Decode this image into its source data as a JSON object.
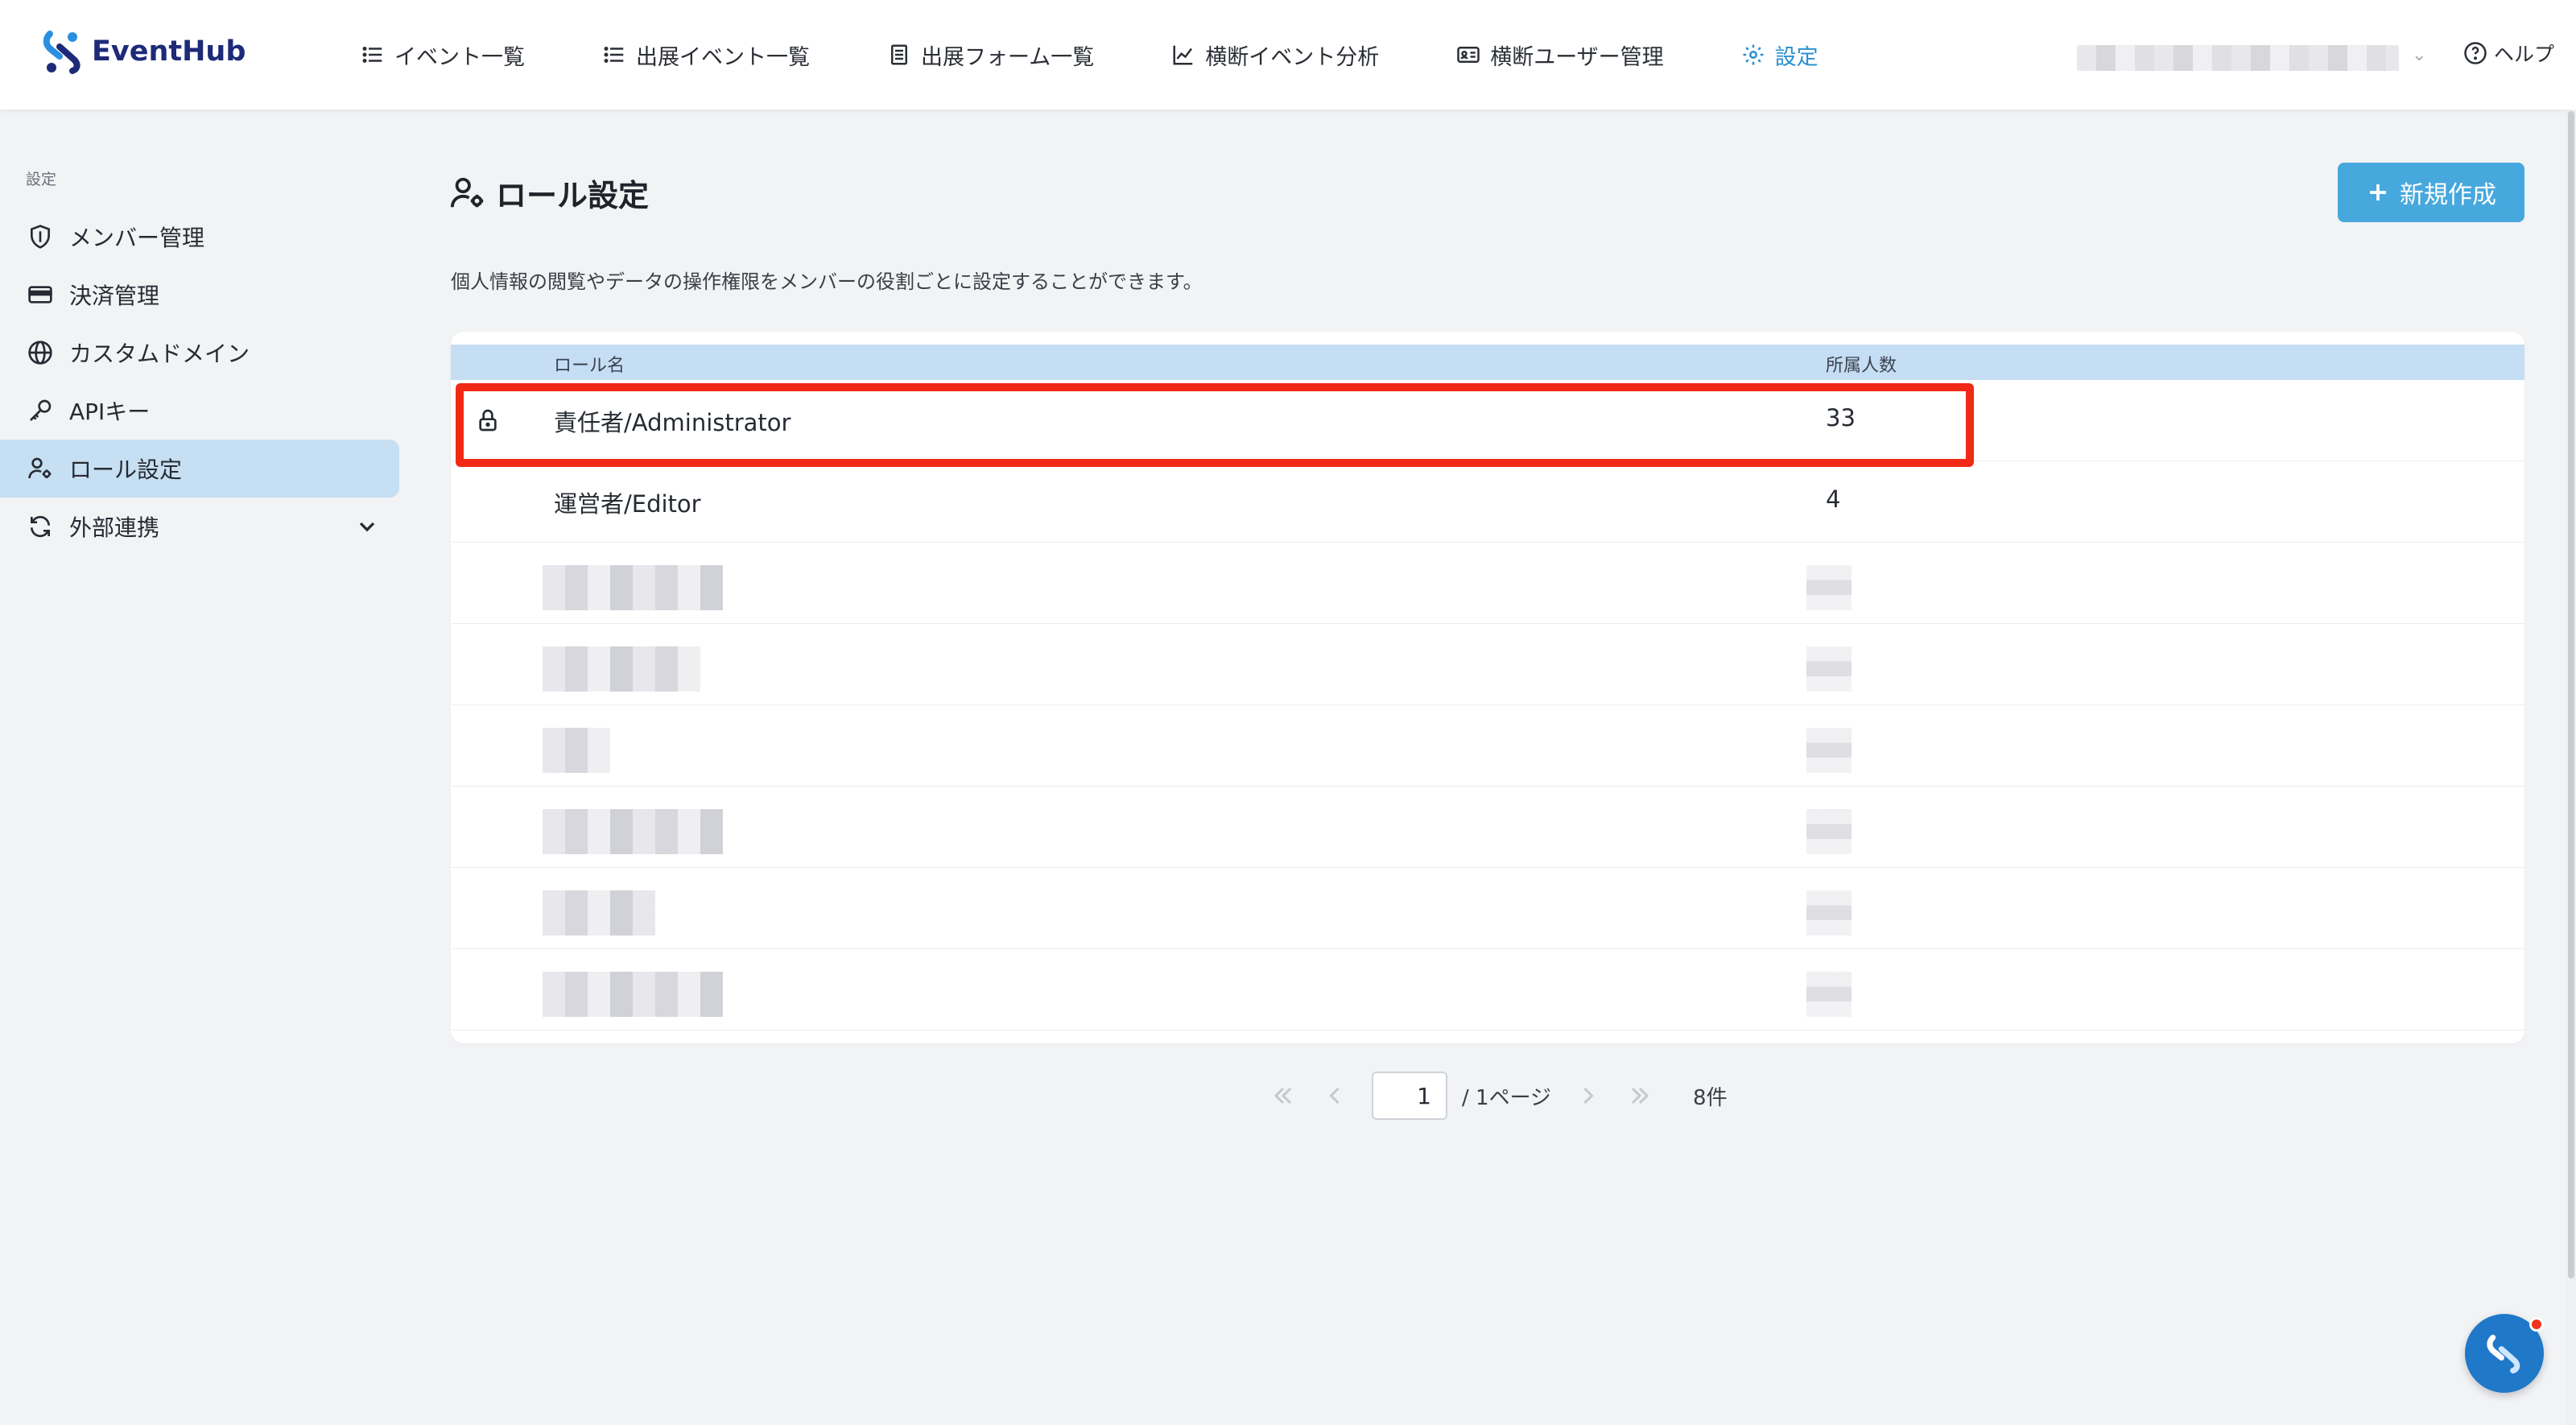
{
  "app": {
    "name": "EventHub"
  },
  "nav": [
    {
      "label": "イベント一覧",
      "icon": "list-icon"
    },
    {
      "label": "出展イベント一覧",
      "icon": "list-icon"
    },
    {
      "label": "出展フォーム一覧",
      "icon": "form-icon"
    },
    {
      "label": "横断イベント分析",
      "icon": "chart-line-icon"
    },
    {
      "label": "横断ユーザー管理",
      "icon": "id-card-icon"
    },
    {
      "label": "設定",
      "icon": "gear-icon",
      "active": true
    }
  ],
  "help_label": "ヘルプ",
  "sidebar": {
    "heading": "設定",
    "items": [
      {
        "label": "メンバー管理",
        "icon": "shield-icon"
      },
      {
        "label": "決済管理",
        "icon": "credit-card-icon"
      },
      {
        "label": "カスタムドメイン",
        "icon": "globe-icon"
      },
      {
        "label": "APIキー",
        "icon": "key-icon"
      },
      {
        "label": "ロール設定",
        "icon": "user-gear-icon",
        "active": true
      },
      {
        "label": "外部連携",
        "icon": "sync-icon",
        "expandable": true
      }
    ]
  },
  "main": {
    "title": "ロール設定",
    "new_button": "新規作成",
    "description": "個人情報の閲覧やデータの操作権限をメンバーの役割ごとに設定することができます。",
    "table": {
      "headers": {
        "name": "ロール名",
        "count": "所属人数"
      },
      "rows": [
        {
          "name": "責任者/Administrator",
          "count": "33",
          "locked": true
        },
        {
          "name": "運営者/Editor",
          "count": "4",
          "locked": false
        }
      ]
    },
    "pagination": {
      "current": "1",
      "of_label": "/ 1ページ",
      "total_label": "8件"
    }
  },
  "colors": {
    "accent": "#2a90d0",
    "button": "#47a8dd",
    "highlight": "#f12a16",
    "header_row": "#c5def3",
    "brand": "#1e2a78"
  }
}
